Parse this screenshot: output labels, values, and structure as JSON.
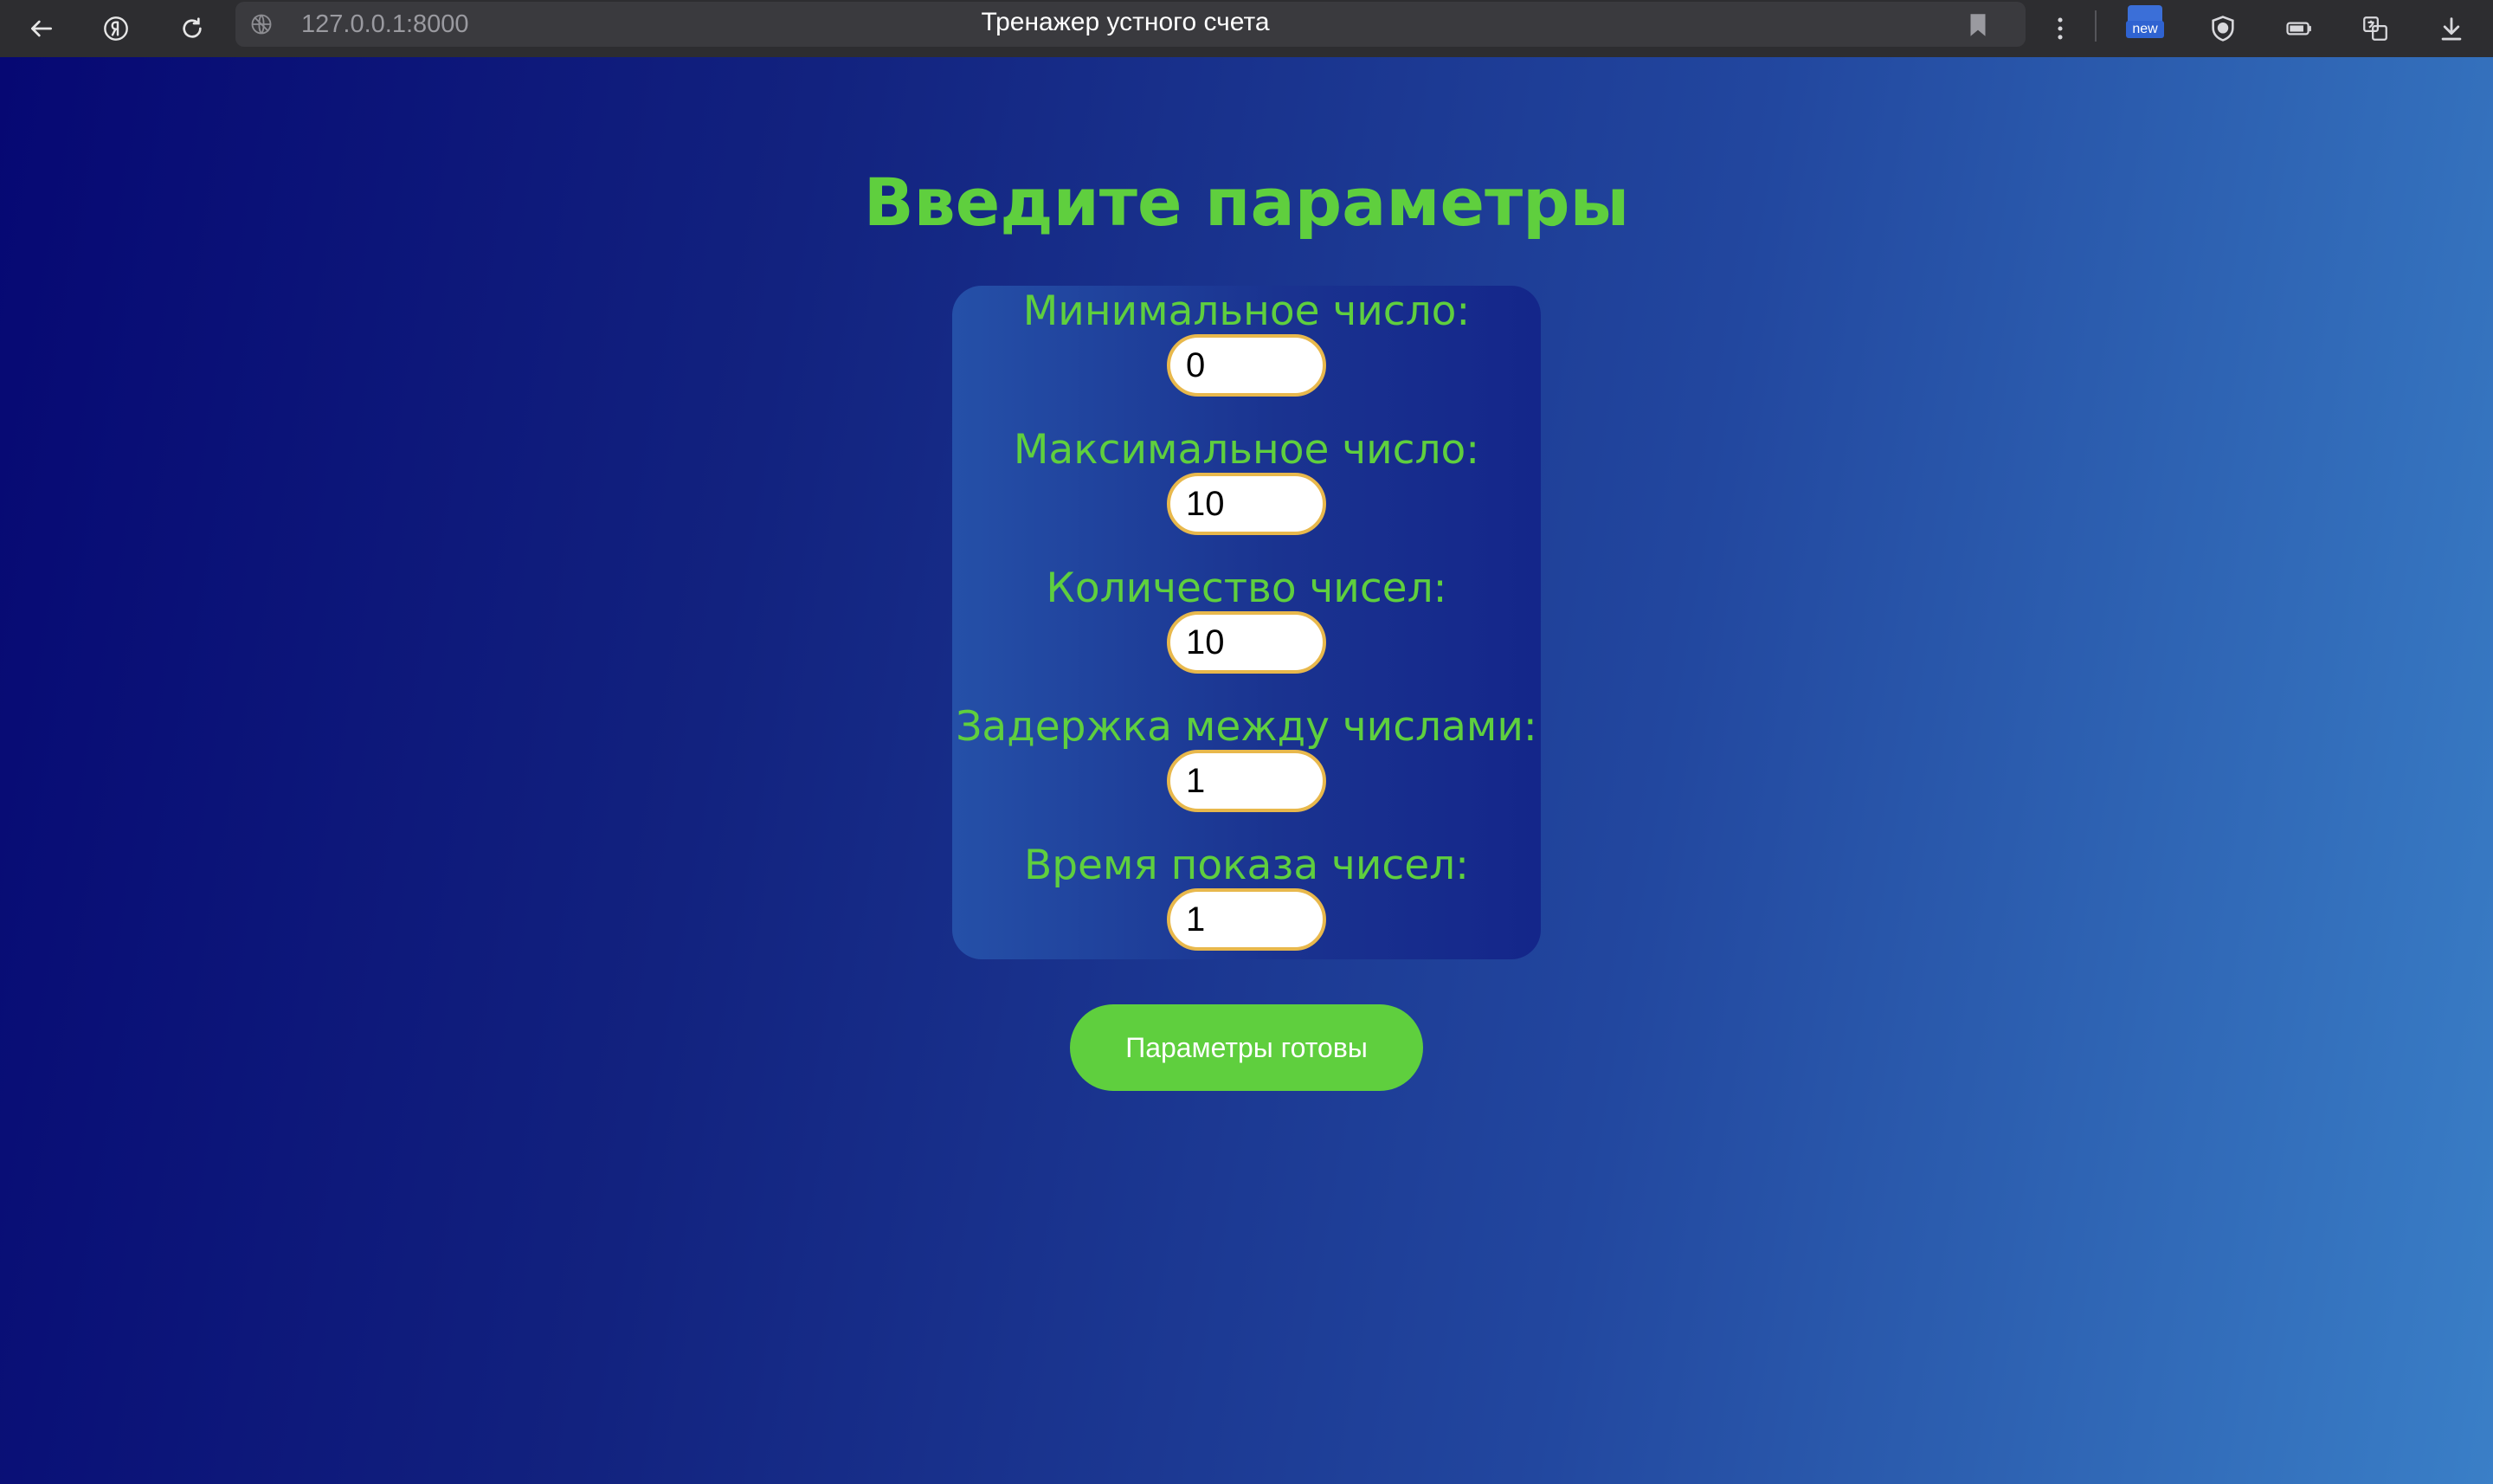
{
  "browser": {
    "url": "127.0.0.1:8000",
    "tab_title": "Тренажер устного счета",
    "new_badge": "new"
  },
  "page": {
    "heading": "Введите параметры",
    "fields": [
      {
        "label": "Минимальное число:",
        "value": "0"
      },
      {
        "label": "Максимальное число:",
        "value": "10"
      },
      {
        "label": "Количество чисел:",
        "value": "10"
      },
      {
        "label": "Задержка между числами:",
        "value": "1"
      },
      {
        "label": "Время показа чисел:",
        "value": "1"
      }
    ],
    "submit_label": "Параметры готовы"
  },
  "colors": {
    "accent_green": "#5fcf3e",
    "input_border": "#e8b84c",
    "chrome_bg": "#2d2d30"
  },
  "icons": [
    "back-arrow-icon",
    "yandex-icon",
    "reload-icon",
    "site-info-icon",
    "bookmark-icon",
    "more-menu-icon",
    "extension-new-icon",
    "shield-icon",
    "battery-icon",
    "translate-icon",
    "download-icon"
  ]
}
